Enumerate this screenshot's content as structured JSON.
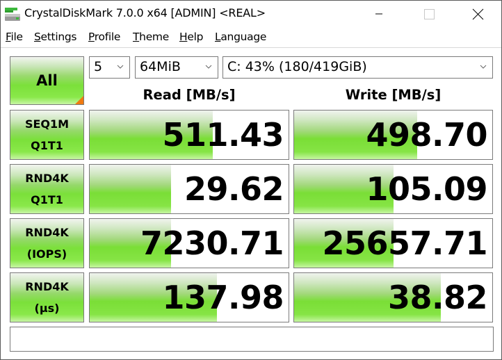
{
  "window": {
    "title": "CrystalDiskMark 7.0.0 x64 [ADMIN] <REAL>",
    "icon": "crystaldiskmark-drive-icon",
    "controls": [
      "minimize",
      "maximize",
      "close"
    ]
  },
  "menu": [
    {
      "label": "File",
      "accel": "F",
      "rest": "ile"
    },
    {
      "label": "Settings",
      "accel": "S",
      "rest": "ettings"
    },
    {
      "label": "Profile",
      "accel": "P",
      "rest": "rofile"
    },
    {
      "label": "Theme",
      "accel": "T",
      "rest": "heme"
    },
    {
      "label": "Help",
      "accel": "H",
      "rest": "elp"
    },
    {
      "label": "Language",
      "accel": "L",
      "rest": "anguage"
    }
  ],
  "toolbar": {
    "all_button": "All",
    "test_count": "5",
    "test_size": "64MiB",
    "drive": "C: 43% (180/419GiB)"
  },
  "columns": {
    "read": "Read [MB/s]",
    "write": "Write [MB/s]"
  },
  "rows": [
    {
      "line1": "SEQ1M",
      "line2": "Q1T1",
      "read": "511.43",
      "write": "498.70",
      "read_fill": 0.62,
      "write_fill": 0.62
    },
    {
      "line1": "RND4K",
      "line2": "Q1T1",
      "read": "29.62",
      "write": "105.09",
      "read_fill": 0.41,
      "write_fill": 0.5
    },
    {
      "line1": "RND4K",
      "line2": "(IOPS)",
      "read": "7230.71",
      "write": "25657.71",
      "read_fill": 0.41,
      "write_fill": 0.5
    },
    {
      "line1": "RND4K",
      "line2": "(µs)",
      "read": "137.98",
      "write": "38.82",
      "read_fill": 0.64,
      "write_fill": 0.74
    }
  ],
  "status": "",
  "colors": {
    "bar_green": "#7ade36",
    "corner_orange": "#f07a10",
    "border": "#7a7a7a"
  }
}
